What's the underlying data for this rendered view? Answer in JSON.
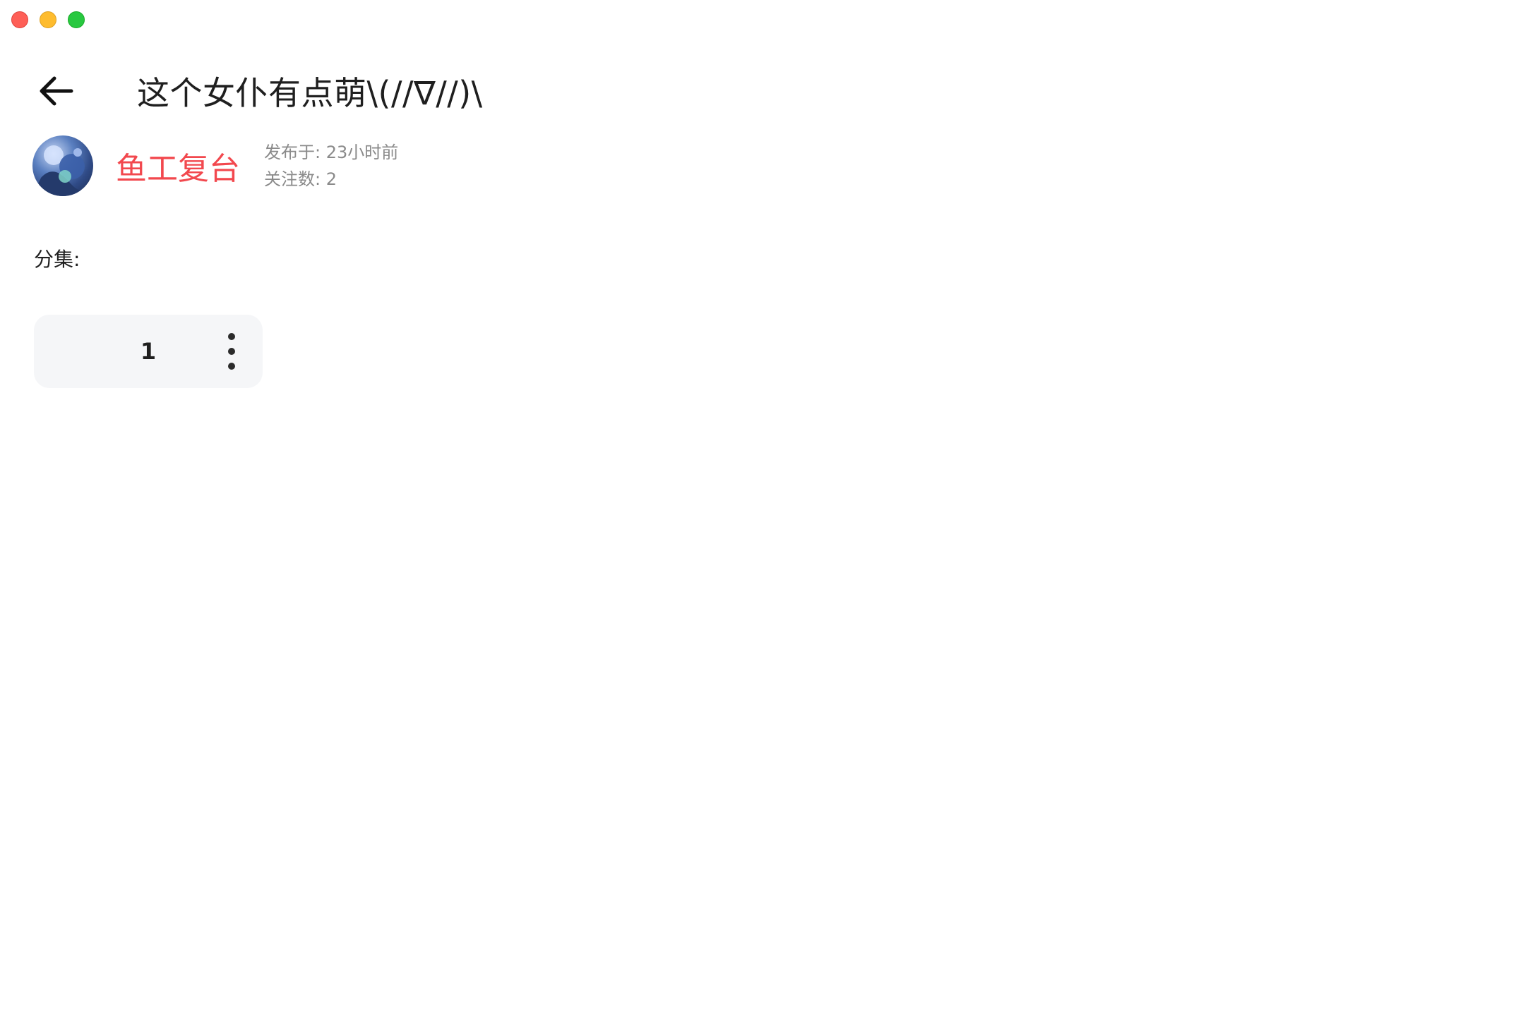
{
  "window": {
    "controls": [
      "close",
      "minimize",
      "maximize"
    ]
  },
  "header": {
    "back_icon": "arrow-left-icon",
    "title": "这个女仆有点萌\\(//∇//)\\"
  },
  "author": {
    "avatar": "avatar-image",
    "name": "鱼工复台",
    "published": "发布于: 23小时前",
    "followers": "关注数: 2"
  },
  "episodes": {
    "label": "分集:",
    "items": [
      {
        "number": "1",
        "menu_icon": "more-vertical-icon"
      }
    ]
  },
  "colors": {
    "accent": "#f2484e",
    "meta_text": "#8a8a8a",
    "card_bg": "#f5f6f8"
  }
}
